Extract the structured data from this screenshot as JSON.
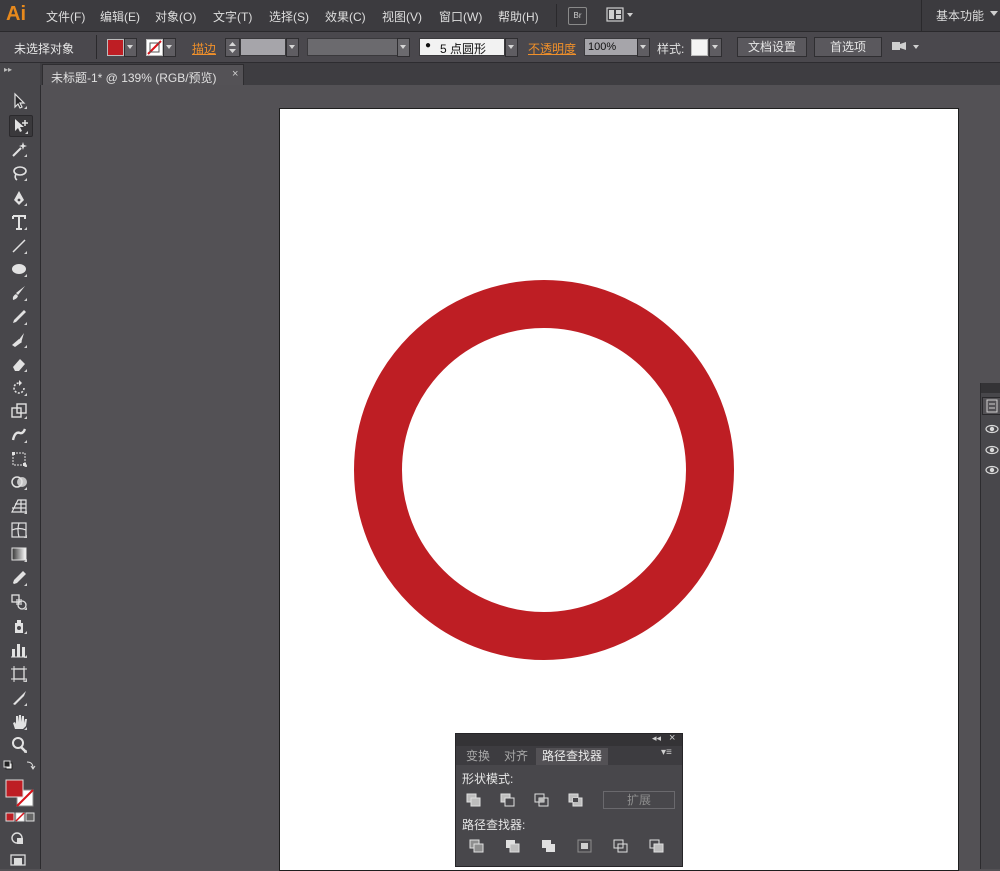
{
  "app": {
    "logo": "Ai"
  },
  "menu": [
    {
      "label": "文件(F)"
    },
    {
      "label": "编辑(E)"
    },
    {
      "label": "对象(O)"
    },
    {
      "label": "文字(T)"
    },
    {
      "label": "选择(S)"
    },
    {
      "label": "效果(C)"
    },
    {
      "label": "视图(V)"
    },
    {
      "label": "窗口(W)"
    },
    {
      "label": "帮助(H)"
    }
  ],
  "bridge_label": "Br",
  "workspace_label": "基本功能",
  "control": {
    "selection_status": "未选择对象",
    "stroke_label": "描边",
    "brush_value": "5 点圆形",
    "opacity_label": "不透明度",
    "opacity_value": "100%",
    "style_label": "样式:",
    "doc_setup_button": "文档设置",
    "preferences_button": "首选项"
  },
  "colors": {
    "fill": "#be1e24",
    "accent": "#e8891c",
    "ring": "#be1e24"
  },
  "document_tab": {
    "title": "未标题-1* @ 139% (RGB/预览)",
    "close": "×"
  },
  "tools": [
    "selection-tool-icon",
    "direct-selection-tool-icon",
    "magic-wand-tool-icon",
    "lasso-tool-icon",
    "pen-tool-icon",
    "type-tool-icon",
    "line-tool-icon",
    "ellipse-tool-icon",
    "paintbrush-tool-icon",
    "pencil-tool-icon",
    "blob-brush-tool-icon",
    "eraser-tool-icon",
    "rotate-tool-icon",
    "scale-tool-icon",
    "warp-tool-icon",
    "free-transform-tool-icon",
    "shape-builder-tool-icon",
    "perspective-grid-tool-icon",
    "mesh-tool-icon",
    "gradient-tool-icon",
    "eyedropper-tool-icon",
    "blend-tool-icon",
    "symbol-sprayer-tool-icon",
    "column-graph-tool-icon",
    "artboard-tool-icon",
    "slice-tool-icon",
    "hand-tool-icon",
    "zoom-tool-icon"
  ],
  "pathfinder": {
    "tabs": [
      "变换",
      "对齐",
      "路径查找器"
    ],
    "shape_modes_label": "形状模式:",
    "expand_button": "扩展",
    "pathfinders_label": "路径查找器:",
    "collapse_glyph": "◂◂",
    "close_glyph": "×",
    "menu_glyph": "▾≡"
  }
}
